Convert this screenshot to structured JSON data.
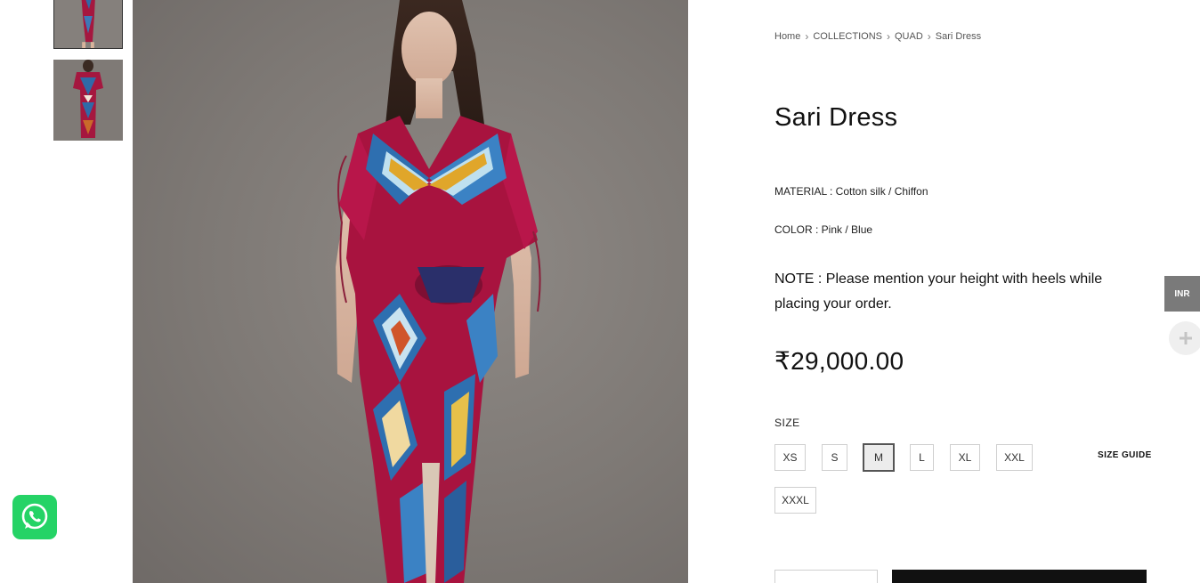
{
  "breadcrumb": {
    "home": "Home",
    "collections": "COLLECTIONS",
    "collection": "QUAD",
    "current": "Sari Dress"
  },
  "product": {
    "title": "Sari Dress",
    "material": "MATERIAL : Cotton silk / Chiffon",
    "color": "COLOR : Pink / Blue",
    "note": "NOTE : Please mention your height with heels while placing your order.",
    "price": "₹29,000.00"
  },
  "sizes": {
    "label": "SIZE",
    "options": [
      "XS",
      "S",
      "M",
      "L",
      "XL",
      "XXL",
      "XXXL"
    ],
    "selected": "M",
    "guide_label": "SIZE GUIDE"
  },
  "currency": {
    "label": "INR"
  },
  "icons": {
    "whatsapp": "whatsapp-icon",
    "plus": "plus-icon",
    "breadcrumb_separator": "chevron-right-icon"
  },
  "colors": {
    "whatsapp_green": "#25d366",
    "currency_tab": "#7a7a7a",
    "add_to_cart": "#111111",
    "dress_pink": "#b0154a",
    "dress_blue": "#2e6fb0"
  }
}
